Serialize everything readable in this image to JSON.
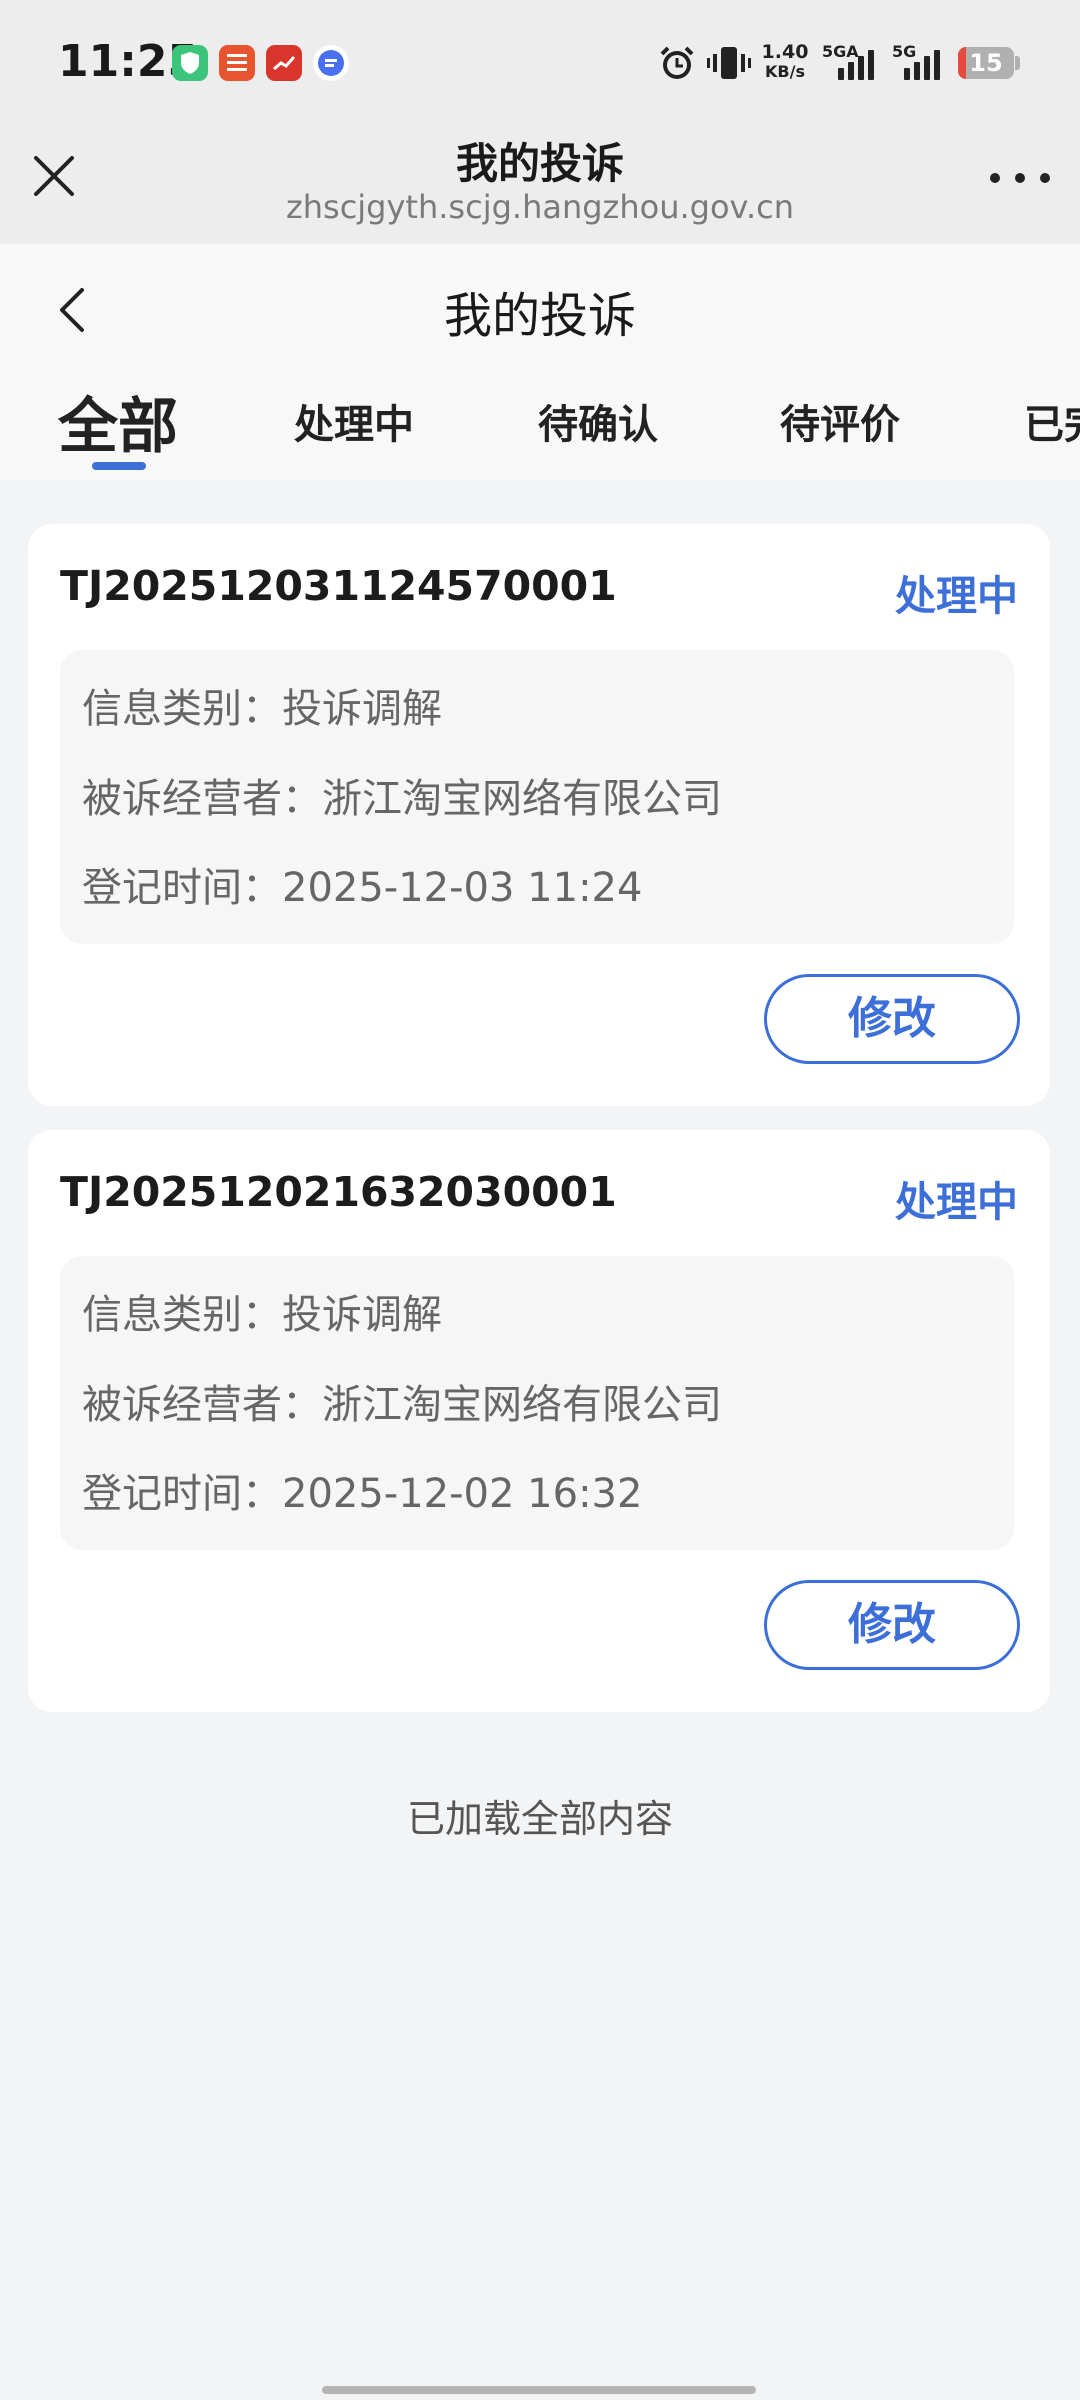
{
  "status_bar": {
    "time": "11:25",
    "net_speed_value": "1.40",
    "net_speed_unit": "KB/s",
    "sim1_label": "5GA",
    "sim2_label": "5G",
    "battery_level": "15",
    "battery_fraction": 0.15,
    "apps": [
      {
        "icon": "shield-app-icon",
        "color": "#3cc57a"
      },
      {
        "icon": "pingan-bank-app-icon",
        "color": "#e8542e",
        "text": "平安银行"
      },
      {
        "icon": "red-app-icon",
        "color": "#d9352c"
      },
      {
        "icon": "chat-app-icon",
        "color": "#4a6ff0"
      }
    ]
  },
  "browser_bar": {
    "title": "我的投诉",
    "url": "zhscjgyth.scjg.hangzhou.gov.cn"
  },
  "header": {
    "title": "我的投诉"
  },
  "tabs": [
    {
      "label": "全部",
      "active": true
    },
    {
      "label": "处理中",
      "active": false
    },
    {
      "label": "待确认",
      "active": false
    },
    {
      "label": "待评价",
      "active": false
    },
    {
      "label": "已完",
      "active": false
    }
  ],
  "complaints": [
    {
      "id": "TJ20251203112457000­1",
      "status": "处理中",
      "category": "信息类别：投诉调解",
      "merchant": "被诉经营者：浙江淘宝网络有限公司",
      "time": "登记时间：2025-12-03 11:24",
      "action": "修改"
    },
    {
      "id": "TJ20251202163203000­1",
      "status": "处理中",
      "category": "信息类别：投诉调解",
      "merchant": "被诉经营者：浙江淘宝网络有限公司",
      "time": "登记时间：2025-12-02 16:32",
      "action": "修改"
    }
  ],
  "footer": {
    "note": "已加载全部内容"
  },
  "colors": {
    "accent": "#3d6fd9",
    "battery_low": "#e64a3c"
  }
}
